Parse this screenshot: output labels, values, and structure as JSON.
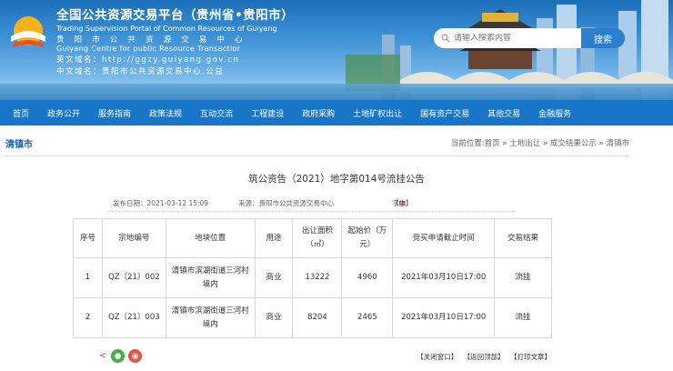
{
  "header": {
    "title_cn": "全国公共资源交易平台（贵州省•贵阳市）",
    "title_en": "Trading Supervision Portal of Common Resources of Guiyang",
    "sub_cn": "贵 阳 市 公 共 资 源 交 易 中 心",
    "sub_en": "Guiyang Centre for public Resource Transactior",
    "domain_en": "英文域名：http://ggzy.guiyang.gov.cn",
    "domain_cn": "中文域名：贵阳市公共资源交易中心.公益",
    "search_placeholder": "请输入搜索内容",
    "search_button": "搜索"
  },
  "nav": [
    "首页",
    "政务公开",
    "服务指南",
    "政策法规",
    "互动交流",
    "工程建设",
    "政府采购",
    "土地矿权出让",
    "国有资产交易",
    "其他交易",
    "金融服务"
  ],
  "location": {
    "section": "清镇市",
    "breadcrumb": "当前位置:首页 » 土地出让 » 成交结果公示 » 清镇市"
  },
  "article": {
    "title": "筑公资告（2021）地字第014号流挂公告",
    "publish_date": "发布日期：2021-03-12 15:09",
    "source": "来源：贵阳市公共资源交易中心",
    "font_label": "字体：",
    "font_small": "【小】",
    "font_mid": "【中】",
    "font_large": "【大】"
  },
  "table": {
    "headers": [
      "序号",
      "宗地编号",
      "地块位置",
      "用途",
      "出让面积（㎡）",
      "起始价（万元）",
      "竞买申请截止时间",
      "交易结果"
    ],
    "rows": [
      [
        "1",
        "QZ〔21〕002",
        "清镇市滨湖街道三河村境内",
        "商业",
        "13222",
        "4960",
        "2021年03月10日17:00",
        "流挂"
      ],
      [
        "2",
        "QZ〔21〕003",
        "清镇市滨湖街道三河村境内",
        "商业",
        "8204",
        "2465",
        "2021年03月10日17:00",
        "流挂"
      ]
    ]
  },
  "footer": {
    "close": "【关闭窗口】",
    "top": "【返回顶部】",
    "print": "【打印文章】"
  },
  "colors": {
    "nav": "#1876c8",
    "accent_red": "#d8292f",
    "section": "#1c64b0"
  }
}
